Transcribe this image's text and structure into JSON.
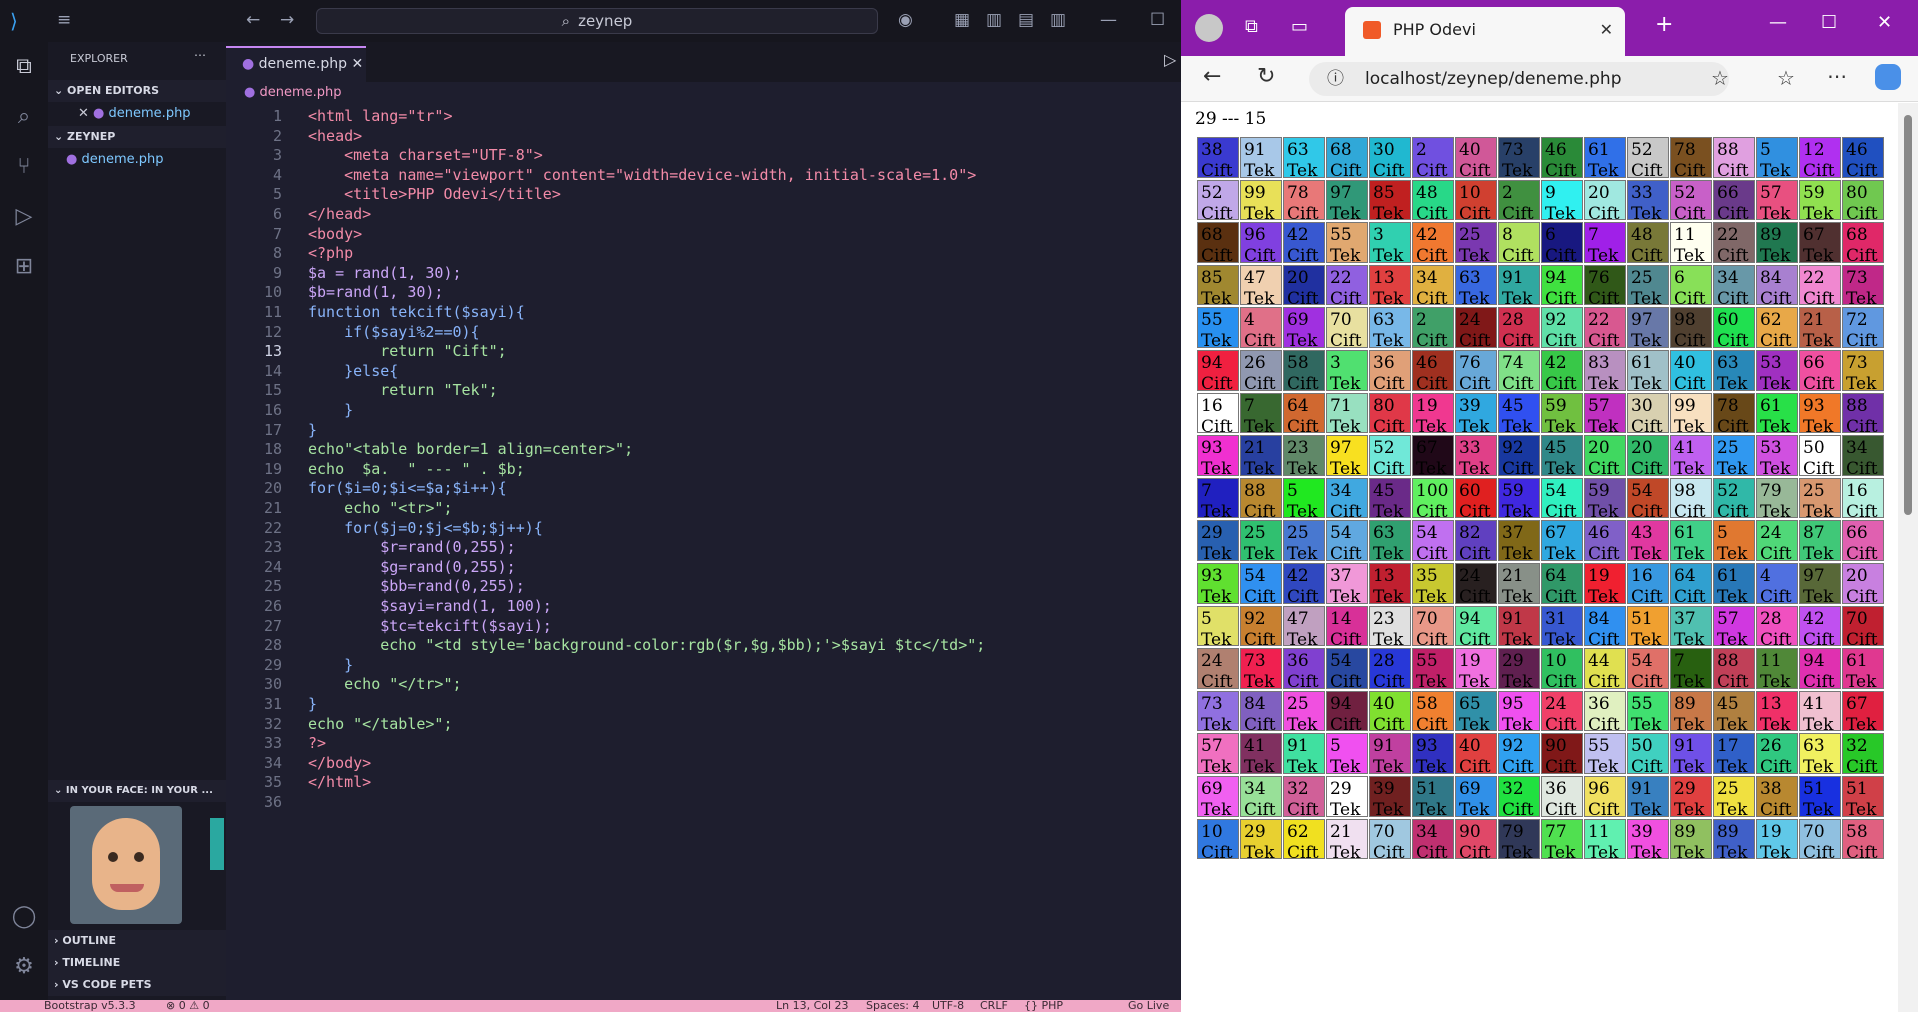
{
  "editor": {
    "search": "zeynep",
    "explorer": "EXPLORER",
    "open_editors": "OPEN EDITORS",
    "workspace": "ZEYNEP",
    "file": "deneme.php",
    "tab": "deneme.php",
    "breadcrumb": "deneme.php",
    "pets": "IN YOUR FACE: IN YOUR ...",
    "outline": "OUTLINE",
    "timeline": "TIMELINE",
    "vs_pets": "VS CODE PETS"
  },
  "code": [
    "<html lang=\"tr\">",
    "<head>",
    "    <meta charset=\"UTF-8\">",
    "    <meta name=\"viewport\" content=\"width=device-width, initial-scale=1.0\">",
    "    <title>PHP Odevi</title>",
    "</head>",
    "<body>",
    "<?php",
    "$a = rand(1, 30);",
    "$b=rand(1, 30);",
    "function tekcift($sayi){",
    "    if($sayi%2==0){",
    "        return \"Cift\";",
    "    }else{",
    "        return \"Tek\";",
    "    }",
    "}",
    "echo\"<table border=1 align=center>\";",
    "echo  $a.  \" --- \" . $b;",
    "for($i=0;$i<=$a;$i++){",
    "    echo \"<tr>\";",
    "    for($j=0;$j<=$b;$j++){",
    "        $r=rand(0,255);",
    "        $g=rand(0,255);",
    "        $bb=rand(0,255);",
    "        $sayi=rand(1, 100);",
    "        $tc=tekcift($sayi);",
    "        echo \"<td style='background-color:rgb($r,$g,$bb);'>$sayi $tc</td>\";",
    "    }",
    "    echo \"</tr>\";",
    "}",
    "echo \"</table>\";",
    "?>",
    "</body>",
    "</html>",
    ""
  ],
  "status": {
    "left": "Bootstrap v5.3.3",
    "errors": "⊗ 0 ⚠ 0",
    "pos": "Ln 13, Col 23",
    "spaces": "Spaces: 4",
    "enc": "UTF-8",
    "eol": "CRLF",
    "lang": "{} PHP",
    "live": "Go Live"
  },
  "browser": {
    "tab_title": "PHP Odevi",
    "url": "localhost/zeynep/deneme.php",
    "header": "29 --- 15"
  },
  "cells": [
    [
      [
        38,
        "Cift",
        "#3a3ad0"
      ],
      [
        91,
        "Tek",
        "#a8c8e8"
      ],
      [
        63,
        "Tek",
        "#30c8e8"
      ],
      [
        68,
        "Cift",
        "#30a8d8"
      ],
      [
        30,
        "Cift",
        "#20b8d0"
      ],
      [
        2,
        "Cift",
        "#7050e0"
      ],
      [
        40,
        "Cift",
        "#d05898"
      ],
      [
        73,
        "Tek",
        "#284068"
      ],
      [
        46,
        "Cift",
        "#2a8a38"
      ],
      [
        61,
        "Tek",
        "#3070e8"
      ],
      [
        52,
        "Cift",
        "#c8c8c8"
      ],
      [
        78,
        "Cift",
        "#7a5020"
      ],
      [
        88,
        "Cift",
        "#e0a0e0"
      ],
      [
        5,
        "Tek",
        "#3090e0"
      ],
      [
        12,
        "Cift",
        "#b030f0"
      ],
      [
        46,
        "Cift",
        "#2050c0"
      ]
    ],
    [
      [
        52,
        "Cift",
        "#c0a8e8"
      ],
      [
        99,
        "Tek",
        "#e8e058"
      ],
      [
        78,
        "Cift",
        "#e87878"
      ],
      [
        97,
        "Tek",
        "#309878"
      ],
      [
        85,
        "Tek",
        "#c02020"
      ],
      [
        48,
        "Cift",
        "#28d888"
      ],
      [
        10,
        "Cift",
        "#d04030"
      ],
      [
        2,
        "Cift",
        "#409040"
      ],
      [
        9,
        "Tek",
        "#30f0f0"
      ],
      [
        20,
        "Cift",
        "#a0e8e0"
      ],
      [
        33,
        "Tek",
        "#4060c8"
      ],
      [
        52,
        "Cift",
        "#c860c8"
      ],
      [
        66,
        "Cift",
        "#6a3a8a"
      ],
      [
        57,
        "Tek",
        "#e85080"
      ],
      [
        59,
        "Tek",
        "#90e050"
      ],
      [
        80,
        "Cift",
        "#70c850"
      ]
    ],
    [
      [
        68,
        "Cift",
        "#5a3010"
      ],
      [
        96,
        "Cift",
        "#8040e0"
      ],
      [
        42,
        "Cift",
        "#3858d0"
      ],
      [
        55,
        "Tek",
        "#e0a870"
      ],
      [
        3,
        "Tek",
        "#30d0b0"
      ],
      [
        42,
        "Cift",
        "#f07830"
      ],
      [
        25,
        "Tek",
        "#7a38b0"
      ],
      [
        8,
        "Cift",
        "#b0e060"
      ],
      [
        6,
        "Cift",
        "#181880"
      ],
      [
        7,
        "Tek",
        "#a020e8"
      ],
      [
        48,
        "Cift",
        "#787838"
      ],
      [
        11,
        "Tek",
        "#fffff0"
      ],
      [
        22,
        "Cift",
        "#806868"
      ],
      [
        89,
        "Tek",
        "#207850"
      ],
      [
        67,
        "Tek",
        "#503030"
      ],
      [
        68,
        "Cift",
        "#e02868"
      ]
    ],
    [
      [
        85,
        "Tek",
        "#a08830"
      ],
      [
        47,
        "Tek",
        "#f0d0b0"
      ],
      [
        20,
        "Cift",
        "#2030a0"
      ],
      [
        22,
        "Cift",
        "#9060e0"
      ],
      [
        13,
        "Tek",
        "#e04040"
      ],
      [
        34,
        "Cift",
        "#e0b040"
      ],
      [
        63,
        "Tek",
        "#3868e0"
      ],
      [
        91,
        "Tek",
        "#30a8a0"
      ],
      [
        94,
        "Cift",
        "#40e040"
      ],
      [
        76,
        "Cift",
        "#305818"
      ],
      [
        25,
        "Tek",
        "#508890"
      ],
      [
        6,
        "Cift",
        "#88e058"
      ],
      [
        34,
        "Cift",
        "#6898a8"
      ],
      [
        84,
        "Cift",
        "#a880d0"
      ],
      [
        22,
        "Cift",
        "#f088d0"
      ],
      [
        73,
        "Tek",
        "#c02888"
      ]
    ],
    [
      [
        55,
        "Tek",
        "#2890f0"
      ],
      [
        4,
        "Cift",
        "#e07088"
      ],
      [
        69,
        "Tek",
        "#a030e0"
      ],
      [
        70,
        "Cift",
        "#e8e0a0"
      ],
      [
        63,
        "Tek",
        "#78b8e8"
      ],
      [
        2,
        "Cift",
        "#40a068"
      ],
      [
        24,
        "Cift",
        "#801818"
      ],
      [
        28,
        "Cift",
        "#d03050"
      ],
      [
        92,
        "Cift",
        "#60e0a8"
      ],
      [
        22,
        "Cift",
        "#d85890"
      ],
      [
        97,
        "Tek",
        "#6878a8"
      ],
      [
        98,
        "Cift",
        "#504030"
      ],
      [
        60,
        "Cift",
        "#20e050"
      ],
      [
        62,
        "Cift",
        "#e8a848"
      ],
      [
        21,
        "Tek",
        "#b86048"
      ],
      [
        72,
        "Cift",
        "#6098e0"
      ]
    ],
    [
      [
        94,
        "Cift",
        "#f02040"
      ],
      [
        26,
        "Cift",
        "#9098b0"
      ],
      [
        58,
        "Cift",
        "#306860"
      ],
      [
        3,
        "Tek",
        "#50e070"
      ],
      [
        36,
        "Cift",
        "#e0a078"
      ],
      [
        46,
        "Cift",
        "#a03020"
      ],
      [
        76,
        "Cift",
        "#68a8d8"
      ],
      [
        74,
        "Cift",
        "#80e088"
      ],
      [
        42,
        "Cift",
        "#38c848"
      ],
      [
        83,
        "Tek",
        "#b890c0"
      ],
      [
        61,
        "Tek",
        "#a0c0c8"
      ],
      [
        40,
        "Cift",
        "#30c0e0"
      ],
      [
        63,
        "Tek",
        "#2888b8"
      ],
      [
        53,
        "Tek",
        "#a030c0"
      ],
      [
        66,
        "Cift",
        "#f050a0"
      ],
      [
        73,
        "Tek",
        "#c8a030"
      ]
    ],
    [
      [
        16,
        "Cift",
        "#ffffff"
      ],
      [
        7,
        "Tek",
        "#386830"
      ],
      [
        64,
        "Cift",
        "#d06830"
      ],
      [
        71,
        "Tek",
        "#98e0c0"
      ],
      [
        80,
        "Cift",
        "#e03848"
      ],
      [
        19,
        "Tek",
        "#f03890"
      ],
      [
        39,
        "Tek",
        "#30a8e0"
      ],
      [
        45,
        "Tek",
        "#3050f0"
      ],
      [
        59,
        "Tek",
        "#70c040"
      ],
      [
        57,
        "Tek",
        "#c030c0"
      ],
      [
        30,
        "Cift",
        "#d8d0b0"
      ],
      [
        99,
        "Tek",
        "#f8e0c0"
      ],
      [
        78,
        "Cift",
        "#684818"
      ],
      [
        61,
        "Tek",
        "#28e048"
      ],
      [
        93,
        "Tek",
        "#f07828"
      ],
      [
        88,
        "Cift",
        "#7030a8"
      ]
    ],
    [
      [
        93,
        "Tek",
        "#f030d0"
      ],
      [
        21,
        "Tek",
        "#2840a0"
      ],
      [
        23,
        "Tek",
        "#608868"
      ],
      [
        97,
        "Tek",
        "#f8e020"
      ],
      [
        52,
        "Cift",
        "#70e8d8"
      ],
      [
        67,
        "Tek",
        "#200818"
      ],
      [
        33,
        "Tek",
        "#e04088"
      ],
      [
        92,
        "Cift",
        "#1838a0"
      ],
      [
        45,
        "Tek",
        "#308888"
      ],
      [
        20,
        "Cift",
        "#40d860"
      ],
      [
        20,
        "Cift",
        "#30b868"
      ],
      [
        41,
        "Tek",
        "#c060f0"
      ],
      [
        25,
        "Tek",
        "#3098f0"
      ],
      [
        53,
        "Tek",
        "#d050e0"
      ],
      [
        50,
        "Cift",
        "#ffffff"
      ],
      [
        34,
        "Cift",
        "#385830"
      ]
    ],
    [
      [
        7,
        "Tek",
        "#2020c0"
      ],
      [
        88,
        "Cift",
        "#b88830"
      ],
      [
        5,
        "Tek",
        "#20e820"
      ],
      [
        34,
        "Cift",
        "#40a8e0"
      ],
      [
        45,
        "Tek",
        "#6a2a88"
      ],
      [
        100,
        "Cift",
        "#60f060"
      ],
      [
        60,
        "Cift",
        "#e02020"
      ],
      [
        59,
        "Tek",
        "#4028e0"
      ],
      [
        54,
        "Cift",
        "#30f0c0"
      ],
      [
        59,
        "Tek",
        "#7050a8"
      ],
      [
        54,
        "Cift",
        "#c04828"
      ],
      [
        98,
        "Cift",
        "#c8e8f0"
      ],
      [
        52,
        "Cift",
        "#30b8a8"
      ],
      [
        79,
        "Tek",
        "#98b898"
      ],
      [
        25,
        "Tek",
        "#d89870"
      ],
      [
        16,
        "Cift",
        "#b8f0e0"
      ]
    ],
    [
      [
        29,
        "Tek",
        "#2860b0"
      ],
      [
        25,
        "Tek",
        "#30c070"
      ],
      [
        25,
        "Tek",
        "#4878d0"
      ],
      [
        54,
        "Cift",
        "#60a8e0"
      ],
      [
        63,
        "Tek",
        "#30a070"
      ],
      [
        54,
        "Cift",
        "#c070f0"
      ],
      [
        82,
        "Cift",
        "#6040c0"
      ],
      [
        37,
        "Tek",
        "#806818"
      ],
      [
        67,
        "Tek",
        "#30a8e0"
      ],
      [
        46,
        "Cift",
        "#8060c8"
      ],
      [
        43,
        "Tek",
        "#e038a0"
      ],
      [
        61,
        "Tek",
        "#40d088"
      ],
      [
        5,
        "Tek",
        "#e07830"
      ],
      [
        24,
        "Cift",
        "#50d878"
      ],
      [
        87,
        "Tek",
        "#40c878"
      ],
      [
        66,
        "Cift",
        "#e060b0"
      ]
    ],
    [
      [
        93,
        "Tek",
        "#60e030"
      ],
      [
        54,
        "Cift",
        "#3090f0"
      ],
      [
        42,
        "Cift",
        "#3048c0"
      ],
      [
        37,
        "Tek",
        "#f098d8"
      ],
      [
        13,
        "Tek",
        "#c02030"
      ],
      [
        35,
        "Tek",
        "#c8c830"
      ],
      [
        24,
        "Cift",
        "#282020"
      ],
      [
        21,
        "Tek",
        "#889088"
      ],
      [
        64,
        "Cift",
        "#309868"
      ],
      [
        19,
        "Tek",
        "#f02030"
      ],
      [
        16,
        "Cift",
        "#3898e0"
      ],
      [
        64,
        "Cift",
        "#30a0d0"
      ],
      [
        61,
        "Tek",
        "#2878b8"
      ],
      [
        4,
        "Cift",
        "#5070e0"
      ],
      [
        97,
        "Tek",
        "#586838"
      ],
      [
        20,
        "Cift",
        "#c880e0"
      ]
    ],
    [
      [
        5,
        "Tek",
        "#e0e068"
      ],
      [
        92,
        "Cift",
        "#c88030"
      ],
      [
        47,
        "Tek",
        "#c0a0c0"
      ],
      [
        14,
        "Cift",
        "#d83098"
      ],
      [
        23,
        "Tek",
        "#e0e0e0"
      ],
      [
        70,
        "Cift",
        "#e89888"
      ],
      [
        94,
        "Cift",
        "#60e8a0"
      ],
      [
        91,
        "Tek",
        "#c03848"
      ],
      [
        31,
        "Tek",
        "#3858d0"
      ],
      [
        84,
        "Cift",
        "#3090f0"
      ],
      [
        51,
        "Tek",
        "#f0a030"
      ],
      [
        37,
        "Tek",
        "#50c0b0"
      ],
      [
        57,
        "Tek",
        "#d038e0"
      ],
      [
        28,
        "Cift",
        "#f050c0"
      ],
      [
        42,
        "Cift",
        "#c050f0"
      ],
      [
        70,
        "Cift",
        "#c02030"
      ]
    ],
    [
      [
        24,
        "Cift",
        "#b08070"
      ],
      [
        73,
        "Tek",
        "#f02050"
      ],
      [
        36,
        "Cift",
        "#8040d0"
      ],
      [
        54,
        "Cift",
        "#2848a0"
      ],
      [
        28,
        "Cift",
        "#2838d8"
      ],
      [
        55,
        "Tek",
        "#c02068"
      ],
      [
        19,
        "Tek",
        "#f070e0"
      ],
      [
        29,
        "Tek",
        "#602050"
      ],
      [
        10,
        "Cift",
        "#30c060"
      ],
      [
        44,
        "Cift",
        "#e0e050"
      ],
      [
        54,
        "Cift",
        "#e07068"
      ],
      [
        7,
        "Tek",
        "#286010"
      ],
      [
        88,
        "Cift",
        "#c04058"
      ],
      [
        11,
        "Tek",
        "#508838"
      ],
      [
        94,
        "Cift",
        "#e030b0"
      ],
      [
        61,
        "Tek",
        "#e03890"
      ]
    ],
    [
      [
        73,
        "Tek",
        "#9070e0"
      ],
      [
        84,
        "Cift",
        "#8060c0"
      ],
      [
        25,
        "Tek",
        "#f050e0"
      ],
      [
        94,
        "Cift",
        "#702040"
      ],
      [
        40,
        "Cift",
        "#80e030"
      ],
      [
        58,
        "Cift",
        "#f08030"
      ],
      [
        65,
        "Tek",
        "#3090a8"
      ],
      [
        95,
        "Tek",
        "#f050f0"
      ],
      [
        24,
        "Cift",
        "#f04068"
      ],
      [
        36,
        "Cift",
        "#e0f0c0"
      ],
      [
        55,
        "Tek",
        "#40e070"
      ],
      [
        89,
        "Tek",
        "#c87848"
      ],
      [
        45,
        "Tek",
        "#b08040"
      ],
      [
        13,
        "Tek",
        "#f03068"
      ],
      [
        41,
        "Tek",
        "#f0c0d0"
      ],
      [
        67,
        "Tek",
        "#e02040"
      ]
    ],
    [
      [
        57,
        "Tek",
        "#f070c0"
      ],
      [
        41,
        "Tek",
        "#803060"
      ],
      [
        91,
        "Tek",
        "#40e0a0"
      ],
      [
        5,
        "Tek",
        "#f050f0"
      ],
      [
        91,
        "Tek",
        "#c040a0"
      ],
      [
        93,
        "Tek",
        "#3030c0"
      ],
      [
        40,
        "Cift",
        "#e04040"
      ],
      [
        92,
        "Cift",
        "#30a0f0"
      ],
      [
        90,
        "Cift",
        "#801818"
      ],
      [
        55,
        "Tek",
        "#c0c0f0"
      ],
      [
        50,
        "Cift",
        "#40d0c0"
      ],
      [
        91,
        "Tek",
        "#7050e8"
      ],
      [
        17,
        "Tek",
        "#3060c8"
      ],
      [
        26,
        "Cift",
        "#30c880"
      ],
      [
        63,
        "Tek",
        "#f0f060"
      ],
      [
        32,
        "Cift",
        "#28c828"
      ]
    ],
    [
      [
        69,
        "Tek",
        "#f060f0"
      ],
      [
        34,
        "Cift",
        "#98e098"
      ],
      [
        32,
        "Cift",
        "#d06098"
      ],
      [
        29,
        "Tek",
        "#ffffff"
      ],
      [
        39,
        "Tek",
        "#702020"
      ],
      [
        51,
        "Tek",
        "#307888"
      ],
      [
        69,
        "Tek",
        "#3090e8"
      ],
      [
        32,
        "Cift",
        "#20e040"
      ],
      [
        36,
        "Cift",
        "#e0e8e0"
      ],
      [
        96,
        "Cift",
        "#f0e060"
      ],
      [
        91,
        "Tek",
        "#3880c0"
      ],
      [
        29,
        "Tek",
        "#e04040"
      ],
      [
        25,
        "Tek",
        "#f0e040"
      ],
      [
        38,
        "Cift",
        "#b88830"
      ],
      [
        51,
        "Tek",
        "#1830e0"
      ],
      [
        51,
        "Tek",
        "#d04048"
      ]
    ],
    [
      [
        10,
        "Cift",
        "#3078e0"
      ],
      [
        29,
        "Tek",
        "#e8d030"
      ],
      [
        62,
        "Cift",
        "#f0e020"
      ],
      [
        21,
        "Tek",
        "#f0e0f0"
      ],
      [
        70,
        "Cift",
        "#a0c8e0"
      ],
      [
        34,
        "Cift",
        "#c03070"
      ],
      [
        90,
        "Cift",
        "#e04868"
      ],
      [
        79,
        "Tek",
        "#303858"
      ],
      [
        77,
        "Tek",
        "#50e050"
      ],
      [
        11,
        "Tek",
        "#60f0b0"
      ],
      [
        39,
        "Tek",
        "#f050e0"
      ],
      [
        89,
        "Tek",
        "#90c060"
      ],
      [
        89,
        "Tek",
        "#4060c8"
      ],
      [
        19,
        "Tek",
        "#60c8e8"
      ],
      [
        70,
        "Cift",
        "#90c0e0"
      ],
      [
        58,
        "Cift",
        "#e06080"
      ]
    ]
  ]
}
